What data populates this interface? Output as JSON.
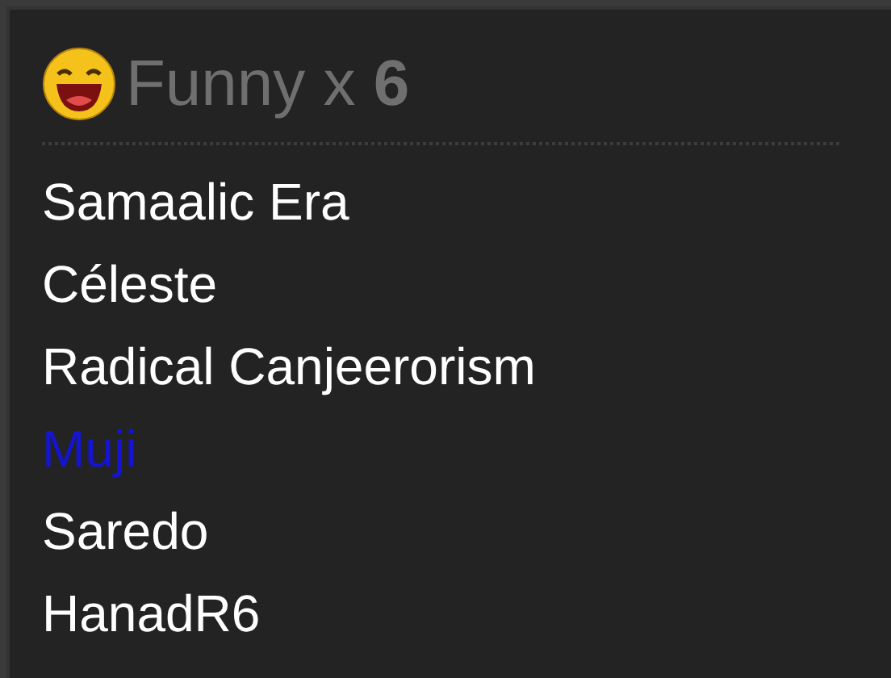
{
  "reaction": {
    "label": "Funny x",
    "count": "6"
  },
  "users": [
    {
      "name": "Samaalic Era",
      "color": "#ffffff"
    },
    {
      "name": "Céleste",
      "color": "#ffffff"
    },
    {
      "name": "Radical Canjeerorism",
      "color": "#ffffff"
    },
    {
      "name": "Muji",
      "color": "#1414d2"
    },
    {
      "name": "Saredo",
      "color": "#ffffff"
    },
    {
      "name": "HanadR6",
      "color": "#ffffff"
    }
  ]
}
